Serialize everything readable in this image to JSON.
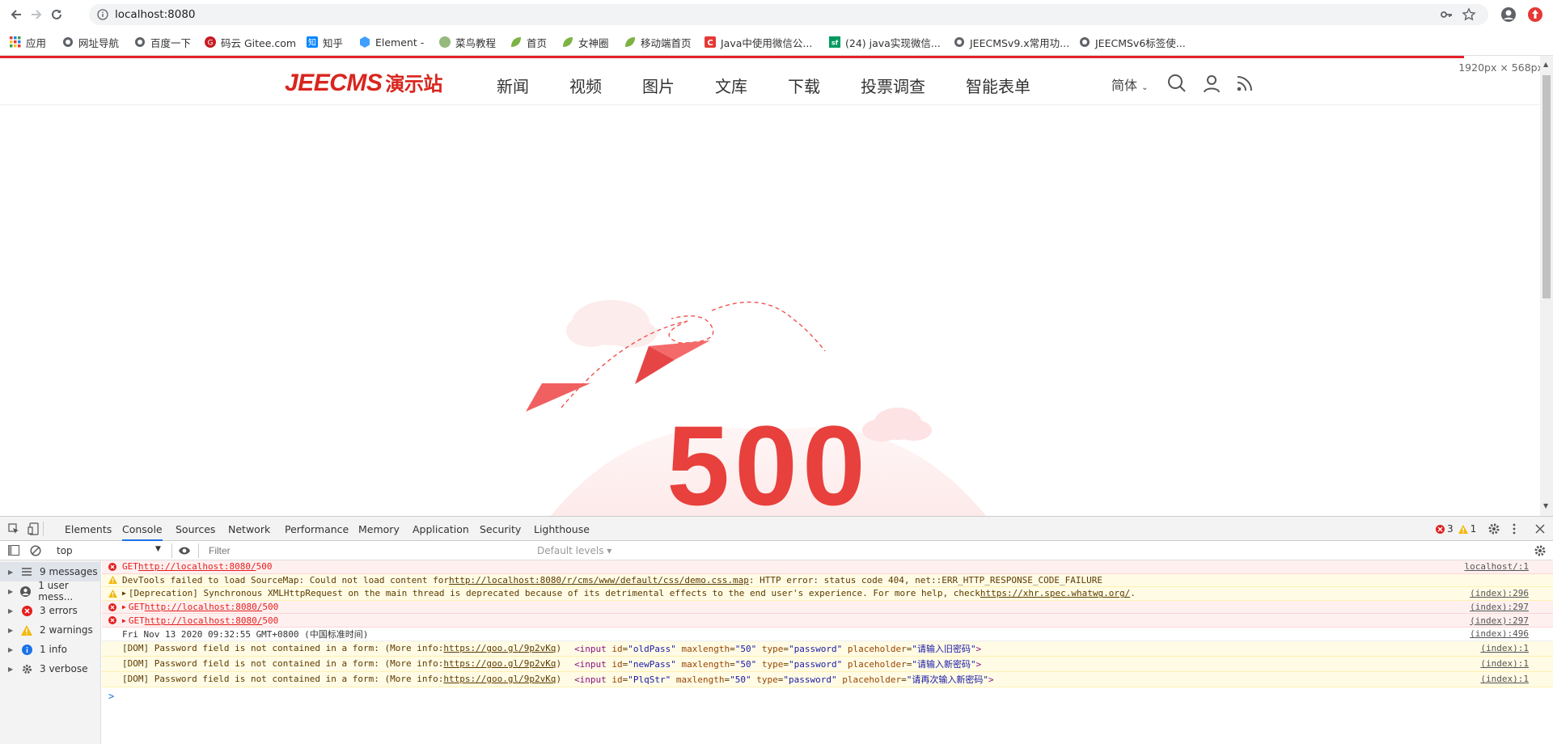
{
  "browser": {
    "url": "localhost:8080",
    "bookmarks": [
      "应用",
      "网址导航",
      "百度一下",
      "码云 Gitee.com",
      "知乎",
      "Element -",
      "菜鸟教程",
      "首页",
      "女神圈",
      "移动端首页",
      "Java中使用微信公...",
      "(24) java实现微信...",
      "JEECMSv9.x常用功...",
      "JEECMSv6标签使..."
    ]
  },
  "page": {
    "size_tag": "1920px × 568px",
    "logo_main": "JEECMS",
    "logo_sub": "演示站",
    "nav": [
      "新闻",
      "视频",
      "图片",
      "文库",
      "下载",
      "投票调查",
      "智能表单"
    ],
    "language": "简体",
    "error_code": "500",
    "colors": {
      "brand_red": "#d9251d",
      "accent_red": "#e8403c"
    }
  },
  "devtools": {
    "tabs": [
      "Elements",
      "Console",
      "Sources",
      "Network",
      "Performance",
      "Memory",
      "Application",
      "Security",
      "Lighthouse"
    ],
    "active_tab": "Console",
    "error_count": "3",
    "warning_count": "1",
    "context": "top",
    "filter_placeholder": "Filter",
    "levels": "Default levels ▾",
    "sidebar": [
      {
        "label": "9 messages",
        "icon": "list-icon"
      },
      {
        "label": "1 user mess...",
        "icon": "user-icon"
      },
      {
        "label": "3 errors",
        "icon": "error-icon"
      },
      {
        "label": "2 warnings",
        "icon": "warning-icon"
      },
      {
        "label": "1 info",
        "icon": "info-icon"
      },
      {
        "label": "3 verbose",
        "icon": "verbose-icon"
      }
    ],
    "messages": [
      {
        "level": "error",
        "prefix": "GET",
        "link": "http://localhost:8080/",
        "text": " 500",
        "source": "localhost/:1",
        "expandable": false
      },
      {
        "level": "warn",
        "prefix": "DevTools failed to load SourceMap: Could not load content for",
        "link": "http://localhost:8080/r/cms/www/default/css/demo.css.map",
        "text": ": HTTP error: status code 404, net::ERR_HTTP_RESPONSE_CODE_FAILURE",
        "source": "",
        "expandable": false
      },
      {
        "level": "warn",
        "prefix": "[Deprecation] Synchronous XMLHttpRequest on the main thread is deprecated because of its detrimental effects to the end user's experience. For more help, check",
        "link": "https://xhr.spec.whatwg.org/",
        "text": ".",
        "source": "(index):296",
        "expandable": true
      },
      {
        "level": "error",
        "prefix": "GET",
        "link": "http://localhost:8080/",
        "text": " 500",
        "source": "(index):297",
        "expandable": true
      },
      {
        "level": "error",
        "prefix": "GET",
        "link": "http://localhost:8080/",
        "text": " 500",
        "source": "(index):297",
        "expandable": true
      },
      {
        "level": "plain",
        "prefix": "Fri Nov 13 2020 09:32:55 GMT+0800 (中国标准时间)",
        "link": "",
        "text": "",
        "source": "(index):496",
        "expandable": false
      }
    ],
    "dom_messages": [
      {
        "prefix": "[DOM] Password field is not contained in a form: (More info:",
        "link": "https://goo.gl/9p2vKq",
        "suffix": ")",
        "id": "oldPass",
        "maxlength": "50",
        "type": "password",
        "placeholder": "请输入旧密码",
        "source": "(index):1"
      },
      {
        "prefix": "[DOM] Password field is not contained in a form: (More info:",
        "link": "https://goo.gl/9p2vKq",
        "suffix": ")",
        "id": "newPass",
        "maxlength": "50",
        "type": "password",
        "placeholder": "请输入新密码",
        "source": "(index):1"
      },
      {
        "prefix": "[DOM] Password field is not contained in a form: (More info:",
        "link": "https://goo.gl/9p2vKq",
        "suffix": ")",
        "id": "PlqStr",
        "maxlength": "50",
        "type": "password",
        "placeholder": "请再次输入新密码",
        "source": "(index):1"
      }
    ],
    "prompt": ">"
  }
}
